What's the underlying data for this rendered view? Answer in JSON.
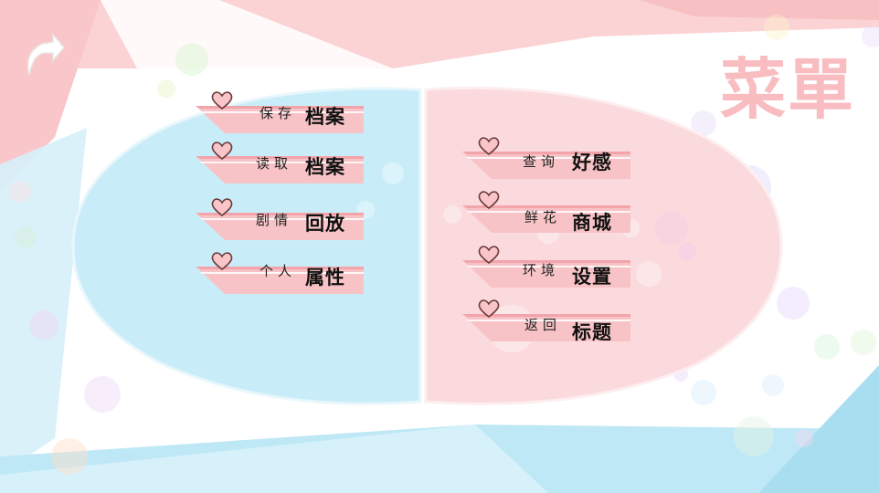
{
  "screen": {
    "title": "菜單",
    "back_button": {
      "icon": "curved-back-arrow-icon"
    }
  },
  "left_panel": {
    "items": [
      {
        "small": "保存",
        "big": "档案",
        "icon": "heart-icon"
      },
      {
        "small": "读取",
        "big": "档案",
        "icon": "heart-icon"
      },
      {
        "small": "剧情",
        "big": "回放",
        "icon": "heart-icon"
      },
      {
        "small": "个人",
        "big": "属性",
        "icon": "heart-icon"
      }
    ]
  },
  "right_panel": {
    "items": [
      {
        "small": "查询",
        "big": "好感",
        "icon": "heart-icon"
      },
      {
        "small": "鲜花",
        "big": "商城",
        "icon": "heart-icon"
      },
      {
        "small": "环境",
        "big": "设置",
        "icon": "heart-icon"
      },
      {
        "small": "返回",
        "big": "标题",
        "icon": "heart-icon"
      }
    ]
  },
  "colors": {
    "pink": "#f8c8cc",
    "blue": "#cdeef9",
    "ribbon_pink": "#f8c3c6",
    "title_pink": "#f8bcc1"
  }
}
